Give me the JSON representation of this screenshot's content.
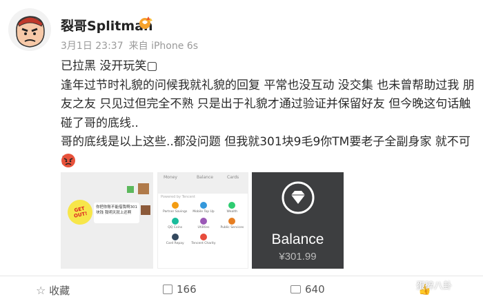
{
  "post": {
    "author": "裂哥Splitman",
    "date": "3月1日 23:37",
    "source": "来自 iPhone 6s",
    "lines": [
      "已拉黑 没开玩笑▢",
      "逢年过节时礼貌的问候我就礼貌的回复 平常也没互动 没交集 也未曾帮助过我 朋",
      "友之友 只见过但完全不熟 只是出于礼貌才通过验证并保留好友 但今晚这句话触",
      "碰了哥的底线..",
      "哥的底线是以上这些..都没问题 但我就301块9毛9你TM要老子全副身家 就不可以"
    ]
  },
  "thumb1": {
    "sticker": "GET OUT!",
    "chat_text": "你把你账不能借我啊301块钱 我明天就上还啊"
  },
  "thumb2": {
    "tabs": [
      "Money",
      "Balance",
      "Cards"
    ],
    "section": "Powered by Tencent",
    "services": [
      "Partner Savings",
      "Mobile Top Up",
      "Wealth",
      "QQ Coins",
      "Utilities",
      "Public Services",
      "Card Repay",
      "Tencent Charity"
    ]
  },
  "thumb3": {
    "title": "Balance",
    "amount": "¥301.99"
  },
  "actions": {
    "favorite": "收藏",
    "repost": "166",
    "comment": "640",
    "like": ""
  },
  "watermark": "蛋碎八卦",
  "colors": {
    "accent": "#ff8200",
    "muted": "#999999",
    "balance_bg": "#3d3e40"
  }
}
